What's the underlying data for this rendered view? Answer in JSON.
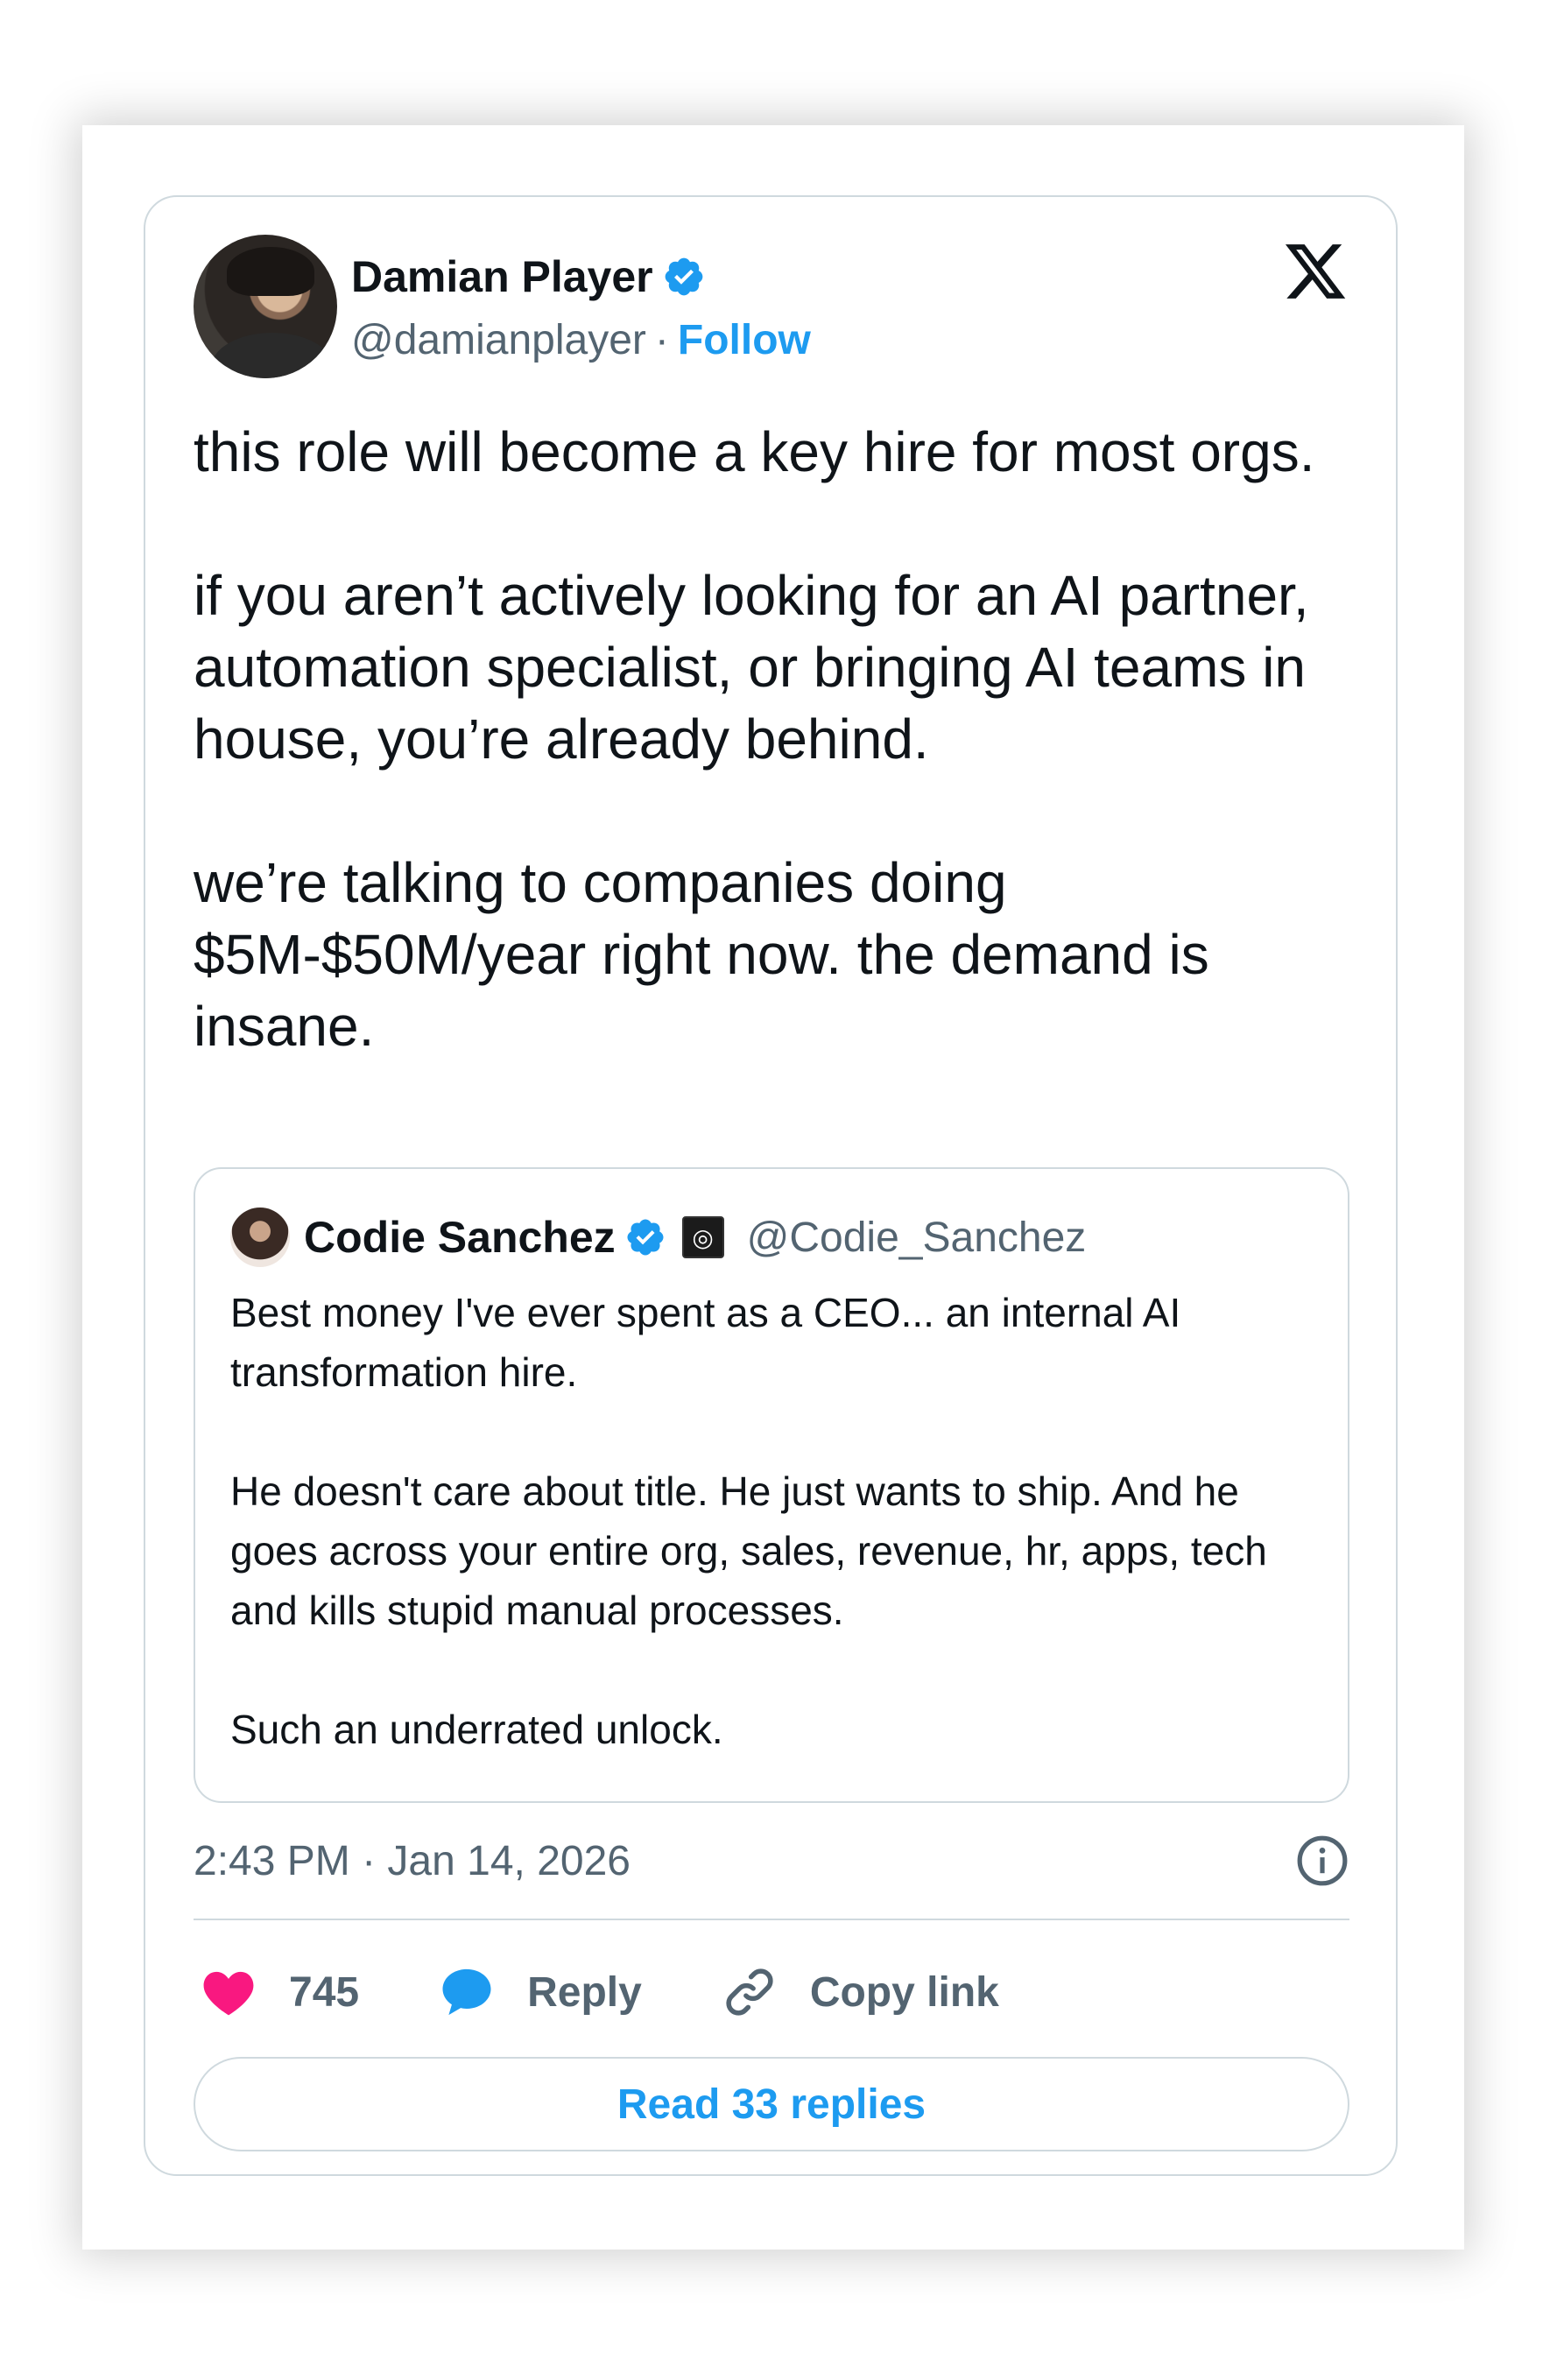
{
  "tweet": {
    "author": {
      "display_name": "Damian Player",
      "handle": "@damianplayer",
      "separator": "·",
      "follow_label": "Follow"
    },
    "platform_logo": "x-logo",
    "body": [
      "this role will become a key hire for most orgs.",
      "if you aren’t actively looking for an AI partner, automation specialist, or bringing AI teams in house, you’re already behind.",
      "we’re talking to companies doing $5M-$50M/year right now. the demand is insane."
    ],
    "quoted": {
      "display_name": "Codie Sanchez",
      "handle": "@Codie_Sanchez",
      "body": [
        "Best money I've ever spent as a CEO... an internal AI transformation hire.",
        "He doesn't care about title. He just wants to ship. And he goes across your entire org, sales, revenue, hr, apps, tech and kills stupid manual processes.",
        "Such an underrated unlock."
      ]
    },
    "timestamp": "2:43 PM · Jan 14, 2026",
    "actions": {
      "like_count": "745",
      "reply_label": "Reply",
      "copy_link_label": "Copy link"
    },
    "read_replies_label": "Read 33 replies"
  },
  "colors": {
    "accent": "#1d9bf0",
    "like": "#f91880",
    "text_primary": "#0f1419",
    "text_secondary": "#536471",
    "border": "#cfd9de"
  }
}
